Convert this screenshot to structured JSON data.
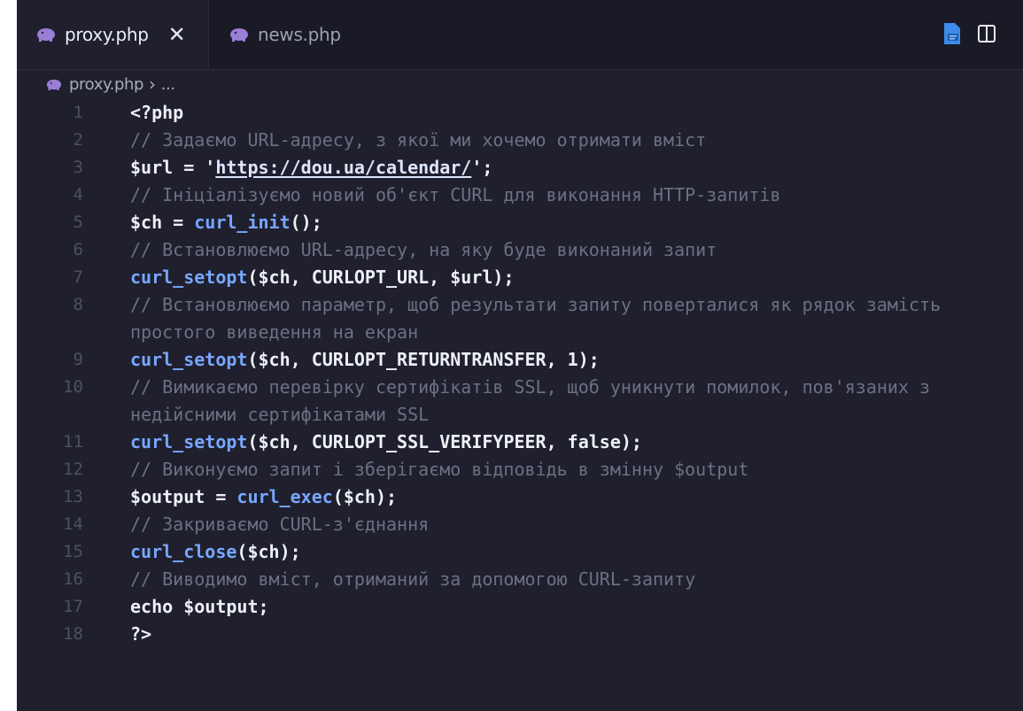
{
  "tabs": [
    {
      "label": "proxy.php",
      "active": true,
      "close_glyph": "✕"
    },
    {
      "label": "news.php",
      "active": false
    }
  ],
  "breadcrumb": {
    "file": "proxy.php",
    "separator": "›",
    "rest": "..."
  },
  "colors": {
    "editor_bg": "#1f1f2e",
    "tab_bar_bg": "#1a1a27",
    "comment": "#6d7082",
    "function": "#78a7ff",
    "line_number": "#4e5061"
  },
  "code": [
    {
      "n": "1",
      "text": "<?php"
    },
    {
      "n": "2",
      "text": "// Задаємо URL-адресу, з якої ми хочемо отримати вміст"
    },
    {
      "n": "3",
      "pre": "$url = '",
      "url": "https://dou.ua/calendar/",
      "post": "';"
    },
    {
      "n": "4",
      "text": "// Ініціалізуємо новий об'єкт CURL для виконання HTTP-запитів"
    },
    {
      "n": "5",
      "pre": "$ch = ",
      "fn": "curl_init",
      "post": "();"
    },
    {
      "n": "6",
      "text": "// Встановлюємо URL-адресу, на яку буде виконаний запит"
    },
    {
      "n": "7",
      "fn": "curl_setopt",
      "post": "($ch, CURLOPT_URL, $url);"
    },
    {
      "n": "8",
      "text": "// Встановлюємо параметр, щоб результати запиту поверталися як рядок замість простого виведення на екран"
    },
    {
      "n": "9",
      "fn": "curl_setopt",
      "post": "($ch, CURLOPT_RETURNTRANSFER, 1);"
    },
    {
      "n": "10",
      "text": "// Вимикаємо перевірку сертифікатів SSL, щоб уникнути помилок, пов'язаних з недійсними сертифікатами SSL"
    },
    {
      "n": "11",
      "fn": "curl_setopt",
      "post": "($ch, CURLOPT_SSL_VERIFYPEER, false);"
    },
    {
      "n": "12",
      "text": "// Виконуємо запит і зберігаємо відповідь в змінну $output"
    },
    {
      "n": "13",
      "pre": "$output = ",
      "fn": "curl_exec",
      "post": "($ch);"
    },
    {
      "n": "14",
      "text": "// Закриваємо CURL-з'єднання"
    },
    {
      "n": "15",
      "fn": "curl_close",
      "post": "($ch);"
    },
    {
      "n": "16",
      "text": "// Виводимо вміст, отриманий за допомогою CURL-запиту"
    },
    {
      "n": "17",
      "pre": "echo $output;"
    },
    {
      "n": "18",
      "pre": "?>"
    }
  ]
}
